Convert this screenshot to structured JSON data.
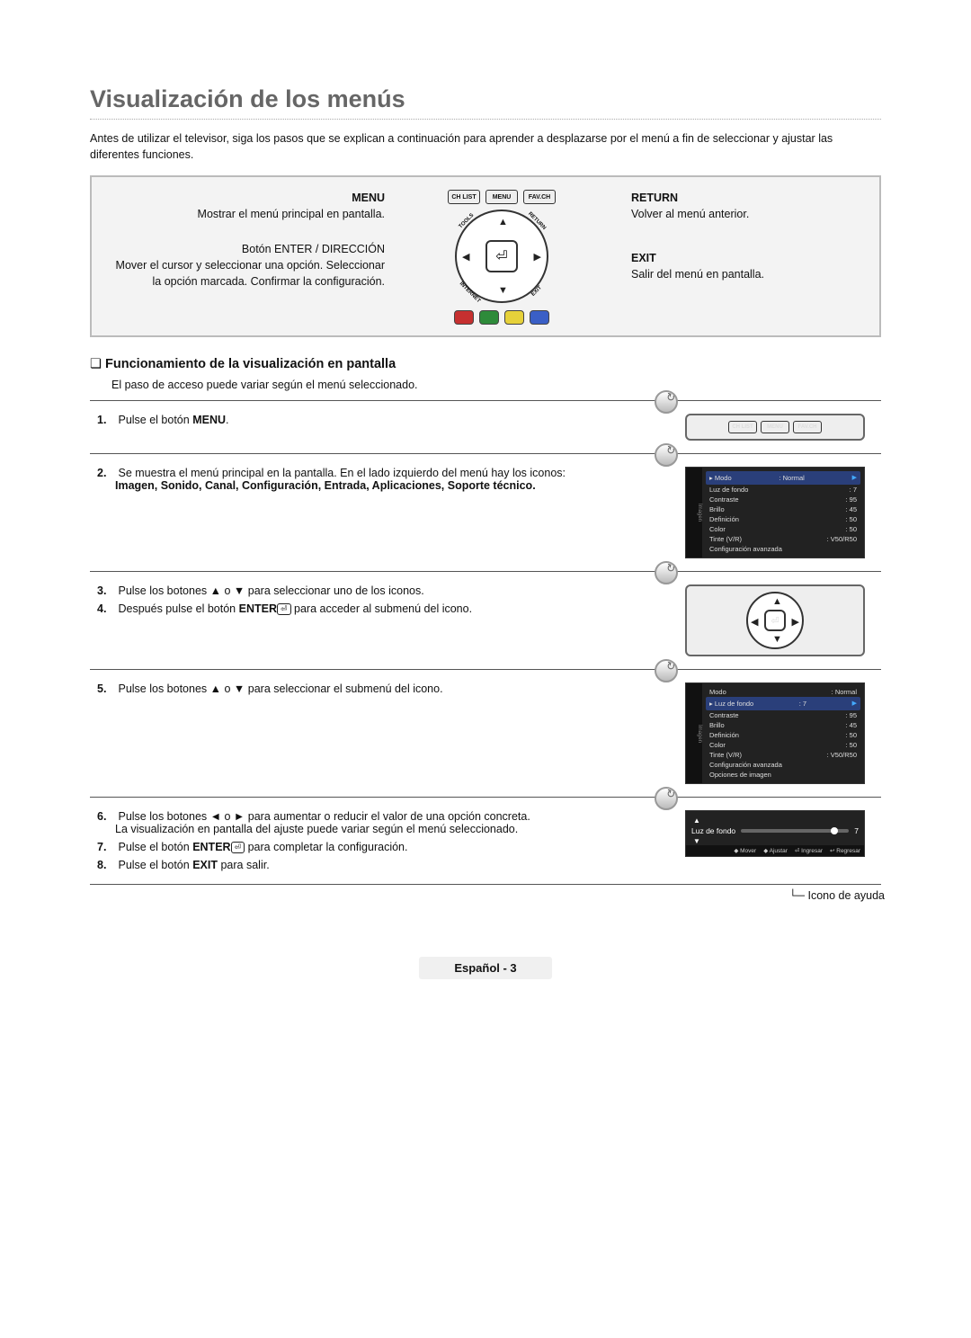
{
  "title": "Visualización de los menús",
  "intro": "Antes de utilizar el televisor, siga los pasos que se explican a continuación para aprender a desplazarse por el menú a fin de seleccionar y ajustar las diferentes funciones.",
  "remote": {
    "top_buttons": [
      "CH LIST",
      "MENU",
      "FAV.CH"
    ],
    "dpad_corners": {
      "tl": "TOOLS",
      "tr": "RETURN",
      "bl": "INTERNET",
      "br": "EXIT"
    },
    "color_buttons": [
      "#c63030",
      "#2e8b3a",
      "#e6d13a",
      "#3a5fc6"
    ],
    "left": {
      "menu_head": "MENU",
      "menu_desc": "Mostrar el menú principal en pantalla.",
      "enter_head": "Botón ENTER / DIRECCIÓN",
      "enter_desc": "Mover el cursor y seleccionar una opción. Seleccionar la opción marcada. Confirmar la configuración."
    },
    "right": {
      "return_head": "RETURN",
      "return_desc": "Volver al menú anterior.",
      "exit_head": "EXIT",
      "exit_desc": "Salir del menú en pantalla."
    }
  },
  "section_heading": "Funcionamiento de la visualización en pantalla",
  "section_intro": "El paso de acceso puede variar según el menú seleccionado.",
  "steps": {
    "s1": {
      "num": "1.",
      "text_pre": "Pulse el botón ",
      "bold": "MENU",
      "text_post": "."
    },
    "s2": {
      "num": "2.",
      "text": "Se muestra el menú principal en la pantalla. En el lado izquierdo del menú hay los iconos:",
      "bold": "Imagen, Sonido, Canal, Configuración, Entrada, Aplicaciones, Soporte técnico."
    },
    "s3": {
      "num": "3.",
      "text": "Pulse los botones ▲ o ▼ para seleccionar uno de los iconos."
    },
    "s4": {
      "num": "4.",
      "pre": "Después pulse el botón ",
      "bold": "ENTER",
      "post": " para acceder al submenú del icono."
    },
    "s5": {
      "num": "5.",
      "text": "Pulse los botones ▲ o ▼ para seleccionar el submenú del icono."
    },
    "s6": {
      "num": "6.",
      "line1": "Pulse los botones ◄ o ► para aumentar o reducir el valor de una opción concreta.",
      "line2": "La visualización en pantalla del ajuste puede variar según el menú seleccionado."
    },
    "s7": {
      "num": "7.",
      "pre": "Pulse el botón ",
      "bold": "ENTER",
      "post": " para completar la configuración."
    },
    "s8": {
      "num": "8.",
      "pre": "Pulse el botón ",
      "bold": "EXIT",
      "post": " para salir."
    }
  },
  "osd": {
    "side_label": "Imagen",
    "rows1": [
      {
        "l": "▸ Modo",
        "r": ": Normal",
        "hl": true,
        "arrow": true
      },
      {
        "l": "Luz de fondo",
        "r": ": 7"
      },
      {
        "l": "Contraste",
        "r": ": 95"
      },
      {
        "l": "Brillo",
        "r": ": 45"
      },
      {
        "l": "Definición",
        "r": ": 50"
      },
      {
        "l": "Color",
        "r": ": 50"
      },
      {
        "l": "Tinte (V/R)",
        "r": ": V50/R50"
      },
      {
        "l": "Configuración avanzada",
        "r": ""
      }
    ],
    "rows2": [
      {
        "l": "Modo",
        "r": ": Normal"
      },
      {
        "l": "▸ Luz de fondo",
        "r": ": 7",
        "hl": true,
        "arrow": true
      },
      {
        "l": "Contraste",
        "r": ": 95"
      },
      {
        "l": "Brillo",
        "r": ": 45"
      },
      {
        "l": "Definición",
        "r": ": 50"
      },
      {
        "l": "Color",
        "r": ": 50"
      },
      {
        "l": "Tinte (V/R)",
        "r": ": V50/R50"
      },
      {
        "l": "Configuración avanzada",
        "r": ""
      },
      {
        "l": "Opciones de imagen",
        "r": ""
      }
    ],
    "slider": {
      "label": "Luz de fondo",
      "value": "7"
    },
    "help_bar": [
      "◆ Mover",
      "◆ Ajustar",
      "⏎ Ingresar",
      "↩ Regresar"
    ],
    "help_label": "Icono de ayuda"
  },
  "footer": "Español - 3"
}
